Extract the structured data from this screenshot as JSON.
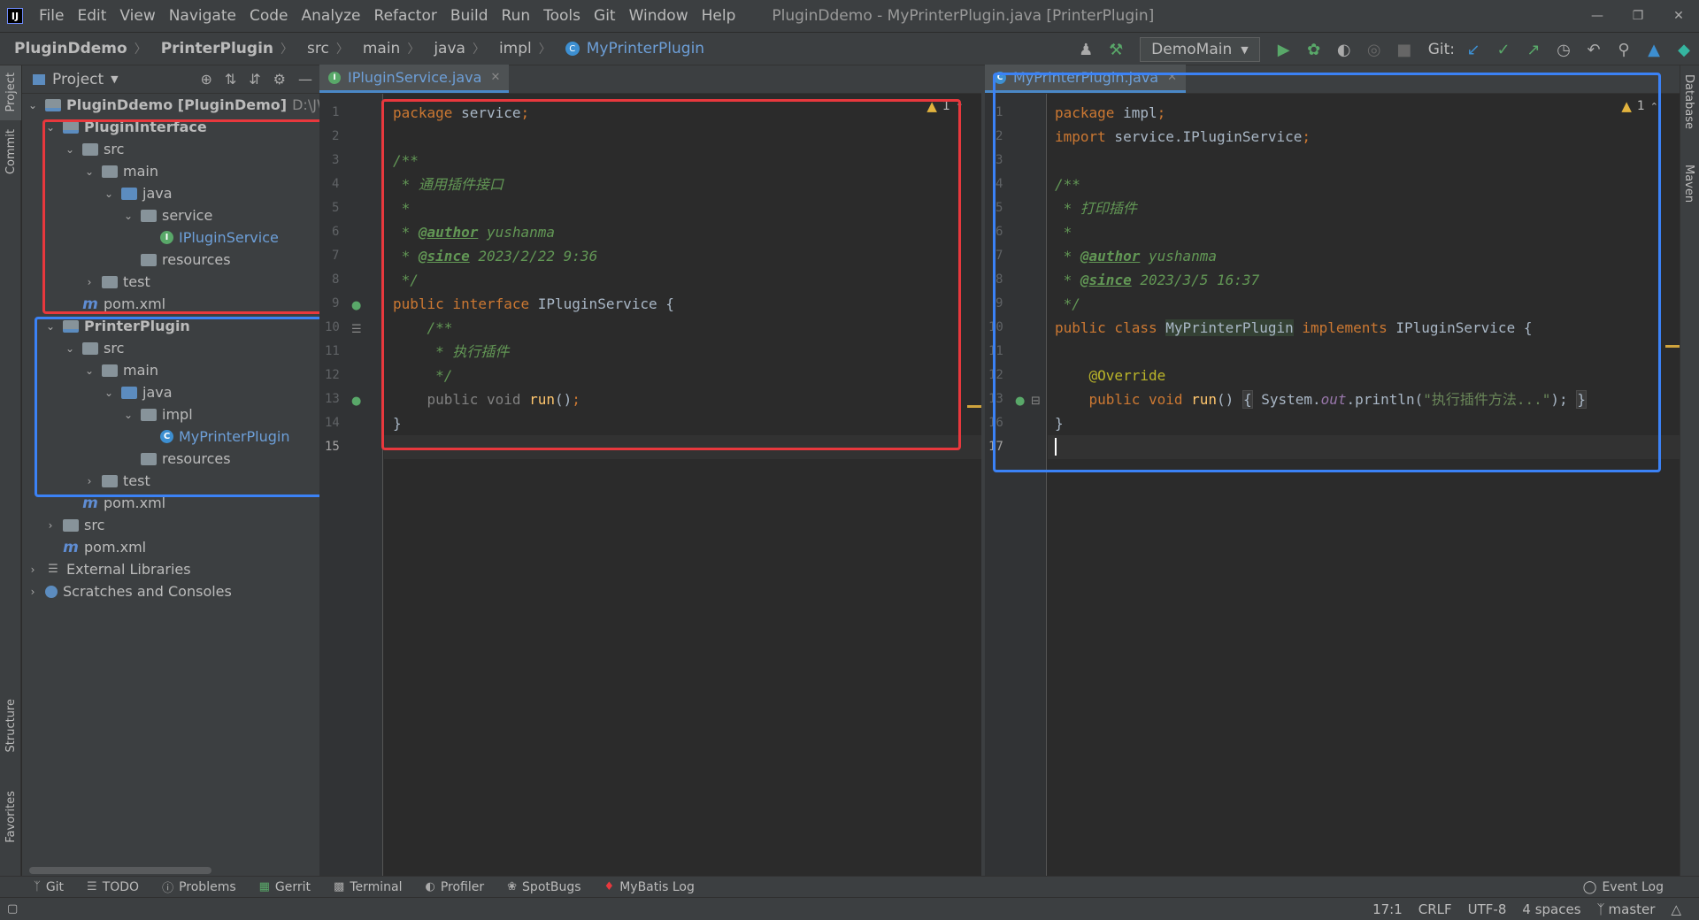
{
  "menubar": {
    "items": [
      "File",
      "Edit",
      "View",
      "Navigate",
      "Code",
      "Analyze",
      "Refactor",
      "Build",
      "Run",
      "Tools",
      "Git",
      "Window",
      "Help"
    ],
    "title": "PluginDdemo - MyPrinterPlugin.java [PrinterPlugin]"
  },
  "navbar": {
    "crumbs": [
      "PluginDdemo",
      "PrinterPlugin",
      "src",
      "main",
      "java",
      "impl",
      "MyPrinterPlugin"
    ],
    "run_config": "DemoMain",
    "git_label": "Git:"
  },
  "left_strip": {
    "project": "Project",
    "commit": "Commit",
    "structure": "Structure",
    "favorites": "Favorites"
  },
  "right_strip": {
    "database": "Database",
    "maven": "Maven"
  },
  "project_panel": {
    "title": "Project",
    "tree": [
      {
        "label": "PluginDdemo [PluginDemo]",
        "path": "D:\\JWc",
        "bold": true
      },
      {
        "label": "PluginInterface",
        "bold": true
      },
      {
        "label": "src"
      },
      {
        "label": "main"
      },
      {
        "label": "java"
      },
      {
        "label": "service"
      },
      {
        "label": "IPluginService"
      },
      {
        "label": "resources"
      },
      {
        "label": "test"
      },
      {
        "label": "pom.xml"
      },
      {
        "label": "PrinterPlugin",
        "bold": true
      },
      {
        "label": "src"
      },
      {
        "label": "main"
      },
      {
        "label": "java"
      },
      {
        "label": "impl"
      },
      {
        "label": "MyPrinterPlugin"
      },
      {
        "label": "resources"
      },
      {
        "label": "test"
      },
      {
        "label": "pom.xml"
      },
      {
        "label": "src"
      },
      {
        "label": "pom.xml"
      },
      {
        "label": "External Libraries"
      },
      {
        "label": "Scratches and Consoles"
      }
    ]
  },
  "editor_left": {
    "tab": "IPluginService.java",
    "warnings": "1",
    "line_numbers": [
      "1",
      "2",
      "3",
      "4",
      "5",
      "6",
      "7",
      "8",
      "9",
      "10",
      "11",
      "12",
      "13",
      "14",
      "15"
    ],
    "code": {
      "l1_kw": "package",
      "l1_id": " service",
      "l1_semi": ";",
      "l3": "/**",
      "l4": " * 通用插件接口",
      "l5": " *",
      "l6_pre": " * ",
      "l6_tag": "@author",
      "l6_val": " yushanma",
      "l7_pre": " * ",
      "l7_tag": "@since",
      "l7_val": " 2023/2/22 9:36",
      "l8": " */",
      "l9_kw": "public interface",
      "l9_id": " IPluginService {",
      "l10": "    /**",
      "l11": "     * 执行插件",
      "l12": "     */",
      "l13_kw": "    public void",
      "l13_fn": " run",
      "l13_rest": "()",
      "l13_semi": ";",
      "l14": "}"
    }
  },
  "editor_right": {
    "tab": "MyPrinterPlugin.java",
    "warnings": "1",
    "line_numbers": [
      "1",
      "2",
      "3",
      "4",
      "5",
      "6",
      "7",
      "8",
      "9",
      "10",
      "11",
      "12",
      "13",
      "16",
      "17"
    ],
    "code": {
      "l1_kw": "package",
      "l1_id": " impl",
      "l1_semi": ";",
      "l2_kw": "import",
      "l2_id": " service.IPluginService",
      "l2_semi": ";",
      "l4": "/**",
      "l5": " * 打印插件",
      "l6": " *",
      "l7_pre": " * ",
      "l7_tag": "@author",
      "l7_val": " yushanma",
      "l8_pre": " * ",
      "l8_tag": "@since",
      "l8_val": " 2023/3/5 16:37",
      "l9": " */",
      "l10_kw": "public class",
      "l10_sp": " ",
      "l10_cls": "MyPrinterPlugin",
      "l10_kw2": " implements",
      "l10_id": " IPluginService {",
      "l12": "    @Override",
      "l13_kw": "    public void",
      "l13_fn": " run",
      "l13_p": "() ",
      "l13_b1": "{",
      "l13_sys": " System.",
      "l13_out": "out",
      "l13_pl": ".println(",
      "l13_str": "\"执行插件方法...\"",
      "l13_cl": ");",
      "l13_sp": " ",
      "l13_b2": "}",
      "l16": "}"
    }
  },
  "bottom_tools": [
    "Git",
    "TODO",
    "Problems",
    "Gerrit",
    "Terminal",
    "Profiler",
    "SpotBugs",
    "MyBatis Log"
  ],
  "event_log": "Event Log",
  "status": {
    "pos": "17:1",
    "eol": "CRLF",
    "enc": "UTF-8",
    "indent": "4 spaces",
    "branch": "master"
  }
}
